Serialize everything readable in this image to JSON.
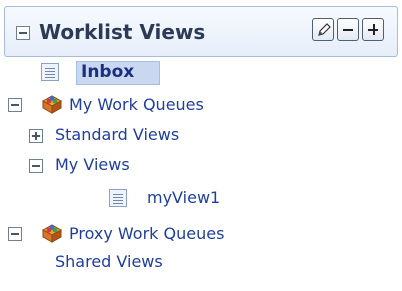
{
  "header": {
    "title": "Worklist Views",
    "collapse_icon": "collapse-minus-icon",
    "tools": [
      {
        "name": "edit-view-button",
        "icon": "pencil-icon"
      },
      {
        "name": "remove-view-button",
        "icon": "minus-icon"
      },
      {
        "name": "add-view-button",
        "icon": "plus-icon"
      }
    ]
  },
  "tree": {
    "inbox": {
      "label": "Inbox",
      "icon": "view-list-icon",
      "selected": true
    },
    "my_work_queues": {
      "label": "My Work Queues",
      "expanded": true,
      "icon": "work-queue-icon"
    },
    "standard_views": {
      "label": "Standard Views",
      "expanded": false
    },
    "my_views": {
      "label": "My Views",
      "expanded": true
    },
    "my_view_1": {
      "label": "myView1",
      "icon": "view-list-icon"
    },
    "proxy_work_queues": {
      "label": "Proxy Work Queues",
      "expanded": true,
      "icon": "work-queue-icon"
    },
    "shared_views": {
      "label": "Shared Views"
    }
  },
  "colors": {
    "link": "#1f3f9e",
    "header_bg": "#e6eefa",
    "selection_bg": "#c9d8f0"
  }
}
